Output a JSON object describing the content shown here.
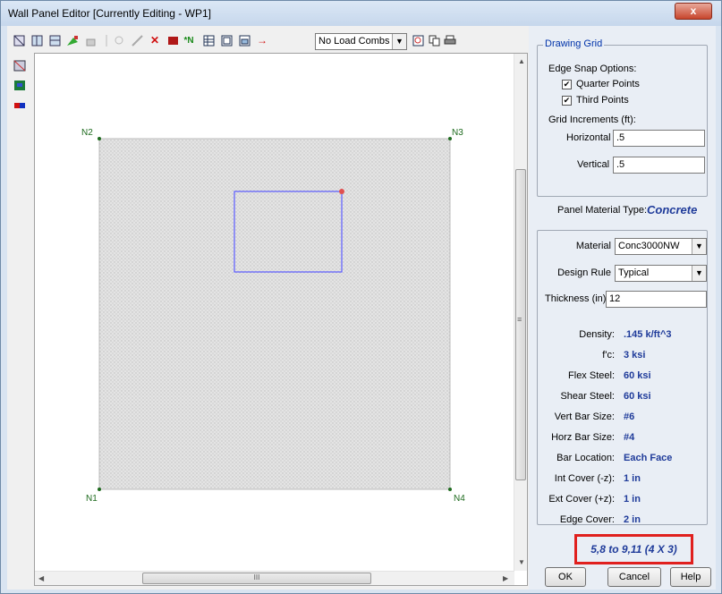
{
  "window": {
    "title": "Wall Panel Editor  [Currently Editing - WP1]",
    "close_label": "x"
  },
  "toolbar": {
    "load_combo_value": "No Load Combs",
    "icons": [
      "panel-icon",
      "panel-region-icon",
      "region-edit-icon",
      "draw-icon",
      "box-icon",
      "separator",
      "snap-icon",
      "line-icon",
      "delete-icon",
      "fill-icon",
      "node-icon",
      "grid-icon",
      "window-icon",
      "window2-icon",
      "load-icon"
    ],
    "right_icons": [
      "zoom-icon",
      "copy-icon",
      "print-icon"
    ]
  },
  "canvas": {
    "nodes": [
      {
        "label": "N1"
      },
      {
        "label": "N2"
      },
      {
        "label": "N3"
      },
      {
        "label": "N4"
      }
    ],
    "hscroll_mark": "III",
    "vscroll_mark": "≡"
  },
  "drawing_grid": {
    "legend": "Drawing Grid",
    "edge_snap_label": "Edge Snap Options:",
    "quarter_points": {
      "label": "Quarter Points",
      "checked": true
    },
    "third_points": {
      "label": "Third Points",
      "checked": true
    },
    "grid_increments_label": "Grid Increments (ft):",
    "horizontal_label": "Horizontal",
    "horizontal_value": ".5",
    "vertical_label": "Vertical",
    "vertical_value": ".5"
  },
  "material": {
    "type_label": "Panel Material Type:",
    "type_value": "Concrete",
    "material_label": "Material",
    "material_value": "Conc3000NW",
    "design_rule_label": "Design Rule",
    "design_rule_value": "Typical",
    "thickness_label": "Thickness (in)",
    "thickness_value": "12",
    "properties": [
      {
        "name": "Density:",
        "value": ".145 k/ft^3"
      },
      {
        "name": "f'c:",
        "value": "3 ksi"
      },
      {
        "name": "Flex Steel:",
        "value": "60 ksi"
      },
      {
        "name": "Shear Steel:",
        "value": "60 ksi"
      },
      {
        "name": "Vert Bar Size:",
        "value": "#6"
      },
      {
        "name": "Horz Bar Size:",
        "value": "#4"
      },
      {
        "name": "Bar Location:",
        "value": "Each Face"
      },
      {
        "name": "Int Cover (-z):",
        "value": "1 in"
      },
      {
        "name": "Ext Cover (+z):",
        "value": "1 in"
      },
      {
        "name": "Edge Cover:",
        "value": "2 in"
      }
    ]
  },
  "status": {
    "coords": "5,8 to 9,11 (4 X 3)"
  },
  "buttons": {
    "ok": "OK",
    "cancel": "Cancel",
    "help": "Help"
  },
  "colors": {
    "selection": "#5a5aff",
    "highlight_box": "#e0201e",
    "value_text": "#1f3b9a",
    "node": "#1e6b1e"
  }
}
